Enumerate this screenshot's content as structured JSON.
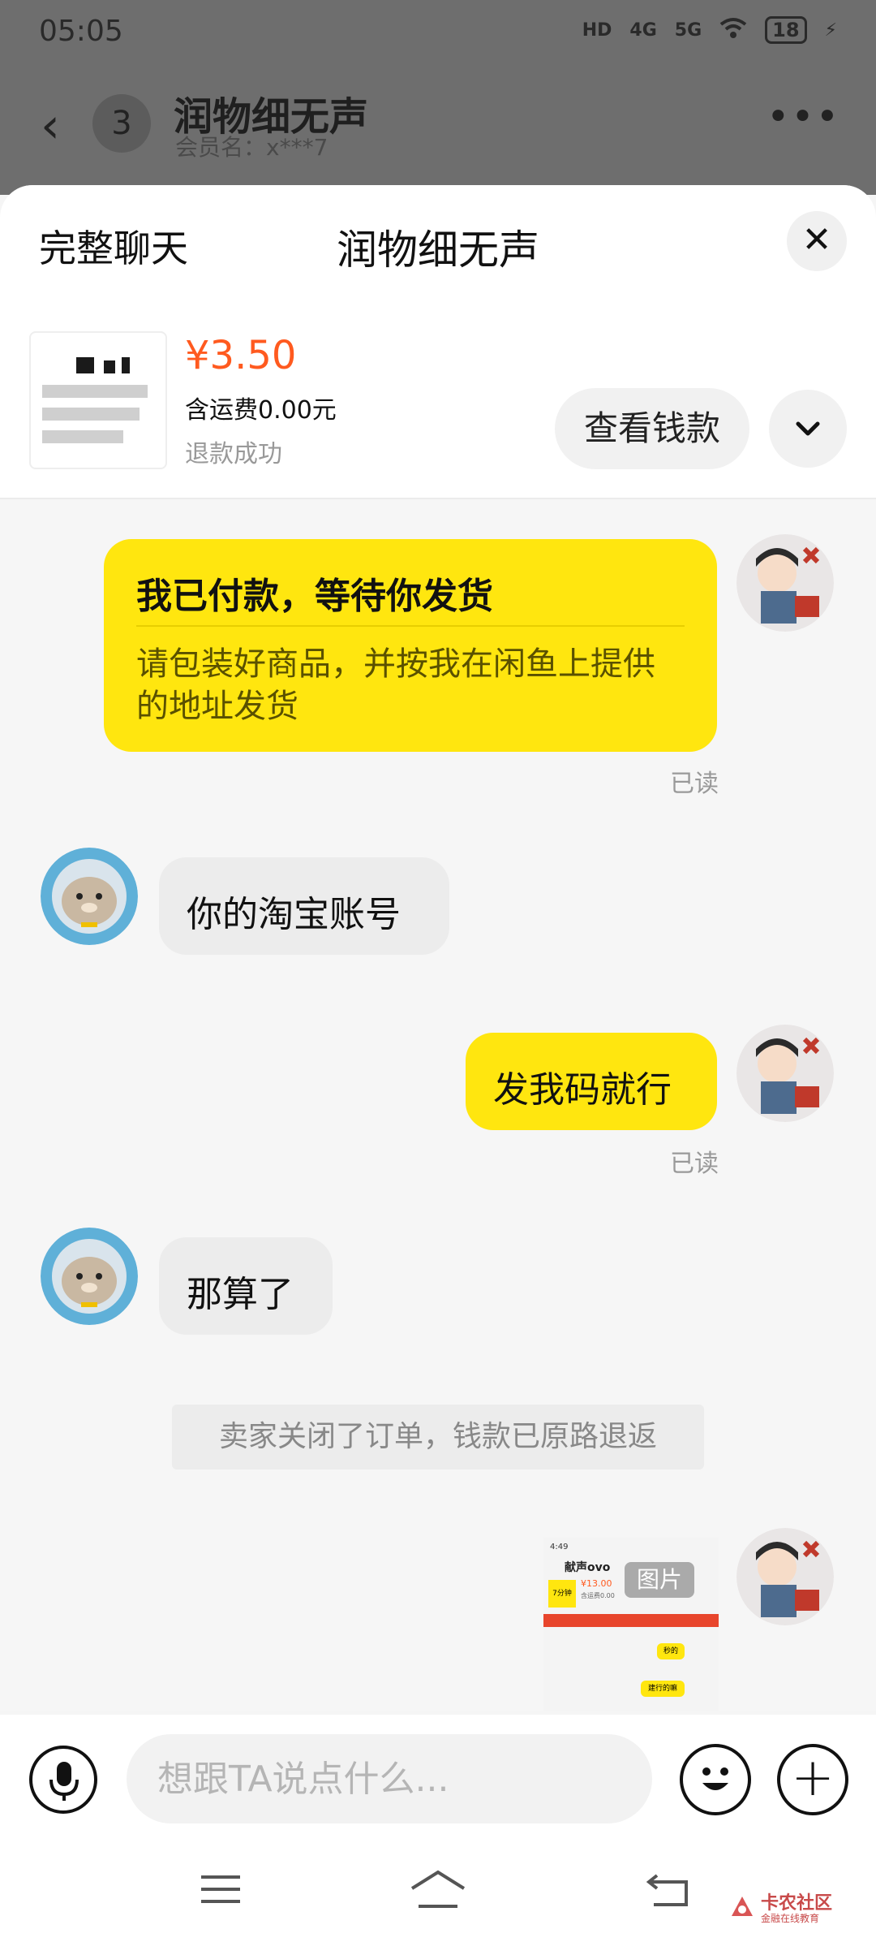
{
  "status_bar": {
    "time": "05:05",
    "hd": "HD",
    "network1": "4G",
    "network2": "5G",
    "battery": "18"
  },
  "background_header": {
    "unread_count": "3",
    "title": "润物细无声",
    "member_label": "会员名：x***7"
  },
  "sheet": {
    "full_chat_label": "完整聊天",
    "title": "润物细无声",
    "close_icon": "close-icon"
  },
  "order": {
    "price": "¥3.50",
    "shipping": "含运费0.00元",
    "status": "退款成功",
    "view_money_label": "查看钱款"
  },
  "messages": [
    {
      "side": "right",
      "type": "card",
      "title": "我已付款，等待你发货",
      "desc": "请包装好商品，并按我在闲鱼上提供的地址发货",
      "read": "已读"
    },
    {
      "side": "left",
      "type": "text",
      "text": "你的淘宝账号"
    },
    {
      "side": "right",
      "type": "text",
      "text": "发我码就行",
      "read": "已读"
    },
    {
      "side": "left",
      "type": "text",
      "text": "那算了"
    },
    {
      "type": "system",
      "text": "卖家关闭了订单，钱款已原路退返"
    },
    {
      "side": "right",
      "type": "image",
      "badge": "图片",
      "thumb": {
        "time": "4:49",
        "name": "献声ovo",
        "price": "¥13.00",
        "shipping": "含运费0.00",
        "tag": "7分钟",
        "reply1": "秒的",
        "reply2": "建行的嘛"
      }
    }
  ],
  "input_bar": {
    "placeholder": "想跟TA说点什么..."
  },
  "watermark": {
    "name": "卡农社区",
    "sub": "金融在线教育"
  },
  "colors": {
    "accent_yellow": "#ffe60f",
    "price_orange": "#ff5a1f"
  }
}
